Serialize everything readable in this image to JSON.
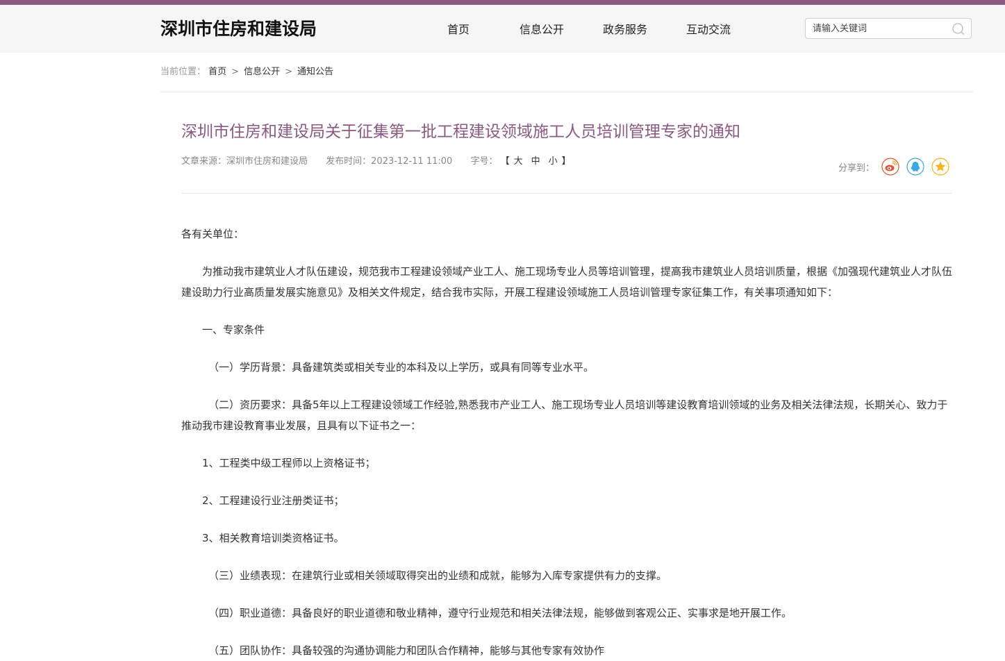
{
  "header": {
    "logo": "深圳市住房和建设局",
    "nav": [
      "首页",
      "信息公开",
      "政务服务",
      "互动交流"
    ],
    "search_placeholder": "请输入关键词"
  },
  "breadcrumb": {
    "label": "当前位置：",
    "items": [
      "首页",
      "信息公开",
      "通知公告"
    ]
  },
  "article": {
    "title": "深圳市住房和建设局关于征集第一批工程建设领域施工人员培训管理专家的通知",
    "source": "文章来源：深圳市住房和建设局",
    "publish_time": "发布时间：2023-12-11 11:00",
    "font_size_label": "字号：",
    "font_sizes": [
      "大",
      "中",
      "小"
    ],
    "share_label": "分享到：",
    "share_icons": [
      "weibo-icon",
      "qq-icon",
      "qzone-icon"
    ],
    "paragraphs": [
      "各有关单位：",
      "为推动我市建筑业人才队伍建设，规范我市工程建设领域产业工人、施工现场专业人员等培训管理，提高我市建筑业人员培训质量，根据《加强现代建筑业人才队伍建设助力行业高质量发展实施意见》及相关文件规定，结合我市实际，开展工程建设领域施工人员培训管理专家征集工作，有关事项通知如下：",
      "一、专家条件",
      "（一）学历背景：具备建筑类或相关专业的本科及以上学历，或具有同等专业水平。",
      "（二）资历要求：具备5年以上工程建设领域工作经验,熟悉我市产业工人、施工现场专业人员培训等建设教育培训领域的业务及相关法律法规，长期关心、致力于推动我市建设教育事业发展，且具有以下证书之一：",
      "1、工程类中级工程师以上资格证书；",
      "2、工程建设行业注册类证书；",
      "3、相关教育培训类资格证书。",
      "（三）业绩表现：在建筑行业或相关领域取得突出的业绩和成就，能够为入库专家提供有力的支撑。",
      "（四）职业道德：具备良好的职业道德和敬业精神，遵守行业规范和相关法律法规，能够做到客观公正、实事求是地开展工作。",
      "（五）团队协作：具备较强的沟通协调能力和团队合作精神，能够与其他专家有效协作"
    ]
  },
  "colors": {
    "accent": "#8a5883",
    "weibo": "#e6522c",
    "qq": "#3aa8e0",
    "qzone": "#f5b51d"
  }
}
